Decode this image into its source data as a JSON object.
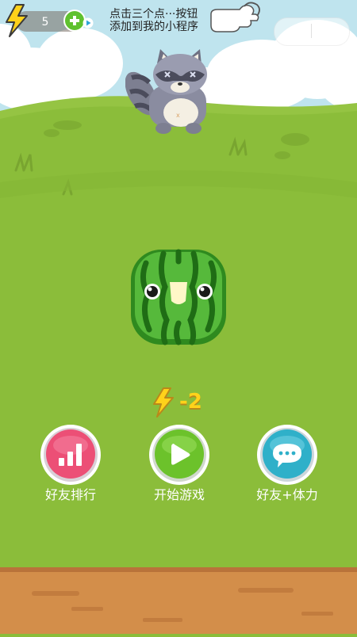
{
  "top_bar": {
    "energy_count": "5",
    "hint_line1": "点击三个点···按钮",
    "hint_line2": "添加到我的小程序"
  },
  "game": {
    "cost_label": "-2"
  },
  "buttons": {
    "rank_label": "好友排行",
    "start_label": "开始游戏",
    "friends_label": "好友+体力"
  },
  "colors": {
    "grass": "#8bbd3a",
    "sky": "#bfe4ee",
    "rank_button": "#ec4f76",
    "start_button": "#6cc22b",
    "friends_button": "#2fb0c9",
    "energy_yellow": "#ffd21a"
  },
  "icons": [
    "lightning-icon",
    "plus-icon",
    "hand-pointer-icon",
    "more-dots-icon",
    "close-circle-icon",
    "bar-chart-icon",
    "play-icon",
    "chat-bubble-icon"
  ]
}
